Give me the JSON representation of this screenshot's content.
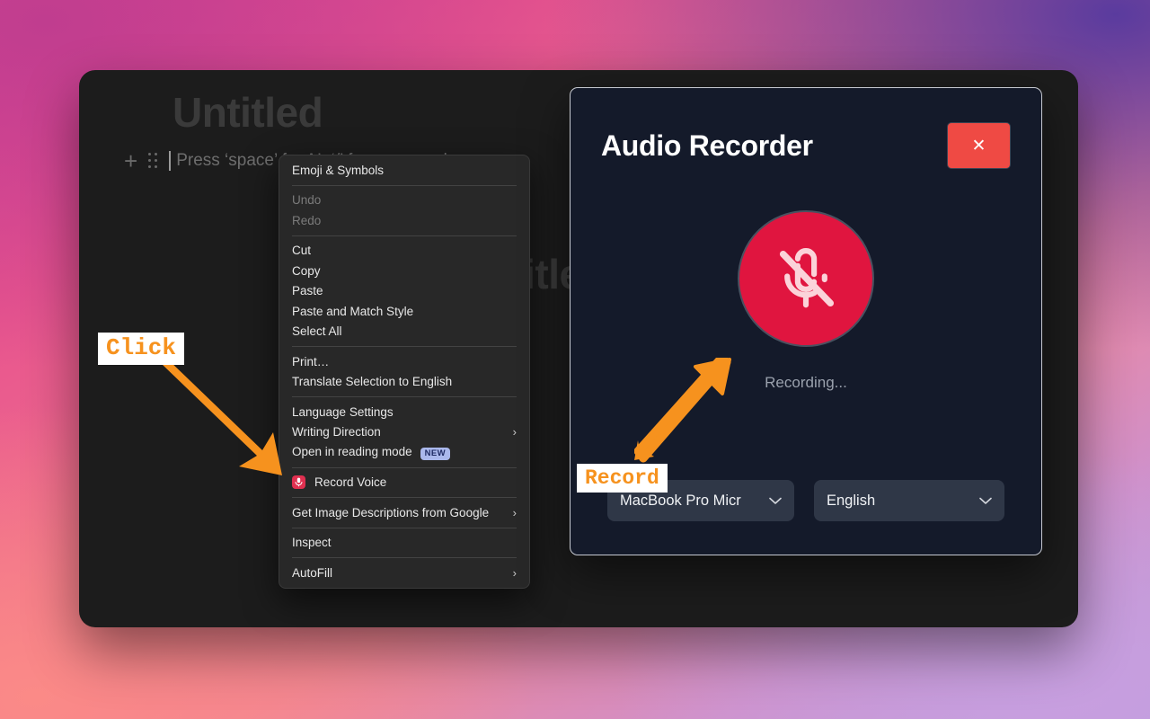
{
  "desktop": {
    "wallpaper_colors": [
      "#de4593",
      "#ef6f8d",
      "#5a3b9e",
      "#b89ddc",
      "#fb8a87"
    ]
  },
  "app_window": {
    "document_title": "Untitled",
    "document_title_ghost": "Untitled",
    "placeholder": "Press ‘space’ for AI, ‘/’ for commands…",
    "placeholder_visible": "Press ‘space’",
    "placeholder_ghost": "or AI,",
    "add_block_icon": "plus-icon",
    "drag_handle_icon": "drag-handle-icon",
    "background_color": "#1c1c1c"
  },
  "context_menu": {
    "groups": [
      {
        "items": [
          {
            "label": "Emoji & Symbols",
            "disabled": false,
            "submenu": false
          }
        ]
      },
      {
        "items": [
          {
            "label": "Undo",
            "disabled": true,
            "submenu": false
          },
          {
            "label": "Redo",
            "disabled": true,
            "submenu": false
          }
        ]
      },
      {
        "items": [
          {
            "label": "Cut",
            "disabled": false,
            "submenu": false
          },
          {
            "label": "Copy",
            "disabled": false,
            "submenu": false
          },
          {
            "label": "Paste",
            "disabled": false,
            "submenu": false
          },
          {
            "label": "Paste and Match Style",
            "disabled": false,
            "submenu": false
          },
          {
            "label": "Select All",
            "disabled": false,
            "submenu": false
          }
        ]
      },
      {
        "items": [
          {
            "label": "Print…",
            "disabled": false,
            "submenu": false
          },
          {
            "label": "Translate Selection to English",
            "disabled": false,
            "submenu": false
          }
        ]
      },
      {
        "items": [
          {
            "label": "Language Settings",
            "disabled": false,
            "submenu": false
          },
          {
            "label": "Writing Direction",
            "disabled": false,
            "submenu": true
          },
          {
            "label": "Open in reading mode",
            "disabled": false,
            "submenu": false,
            "badge": "NEW"
          }
        ]
      },
      {
        "items": [
          {
            "label": "Record Voice",
            "disabled": false,
            "submenu": false,
            "icon": "microphone-icon"
          }
        ]
      },
      {
        "items": [
          {
            "label": "Get Image Descriptions from Google",
            "disabled": false,
            "submenu": true
          }
        ]
      },
      {
        "items": [
          {
            "label": "Inspect",
            "disabled": false,
            "submenu": false
          }
        ]
      },
      {
        "items": [
          {
            "label": "AutoFill",
            "disabled": false,
            "submenu": true
          }
        ]
      }
    ],
    "submenu_arrow_glyph": "›",
    "background_color": "#282828"
  },
  "audio_recorder": {
    "title": "Audio Recorder",
    "close_label": "✕",
    "close_color": "#ef4a44",
    "mic_button_icon": "microphone-slash-icon",
    "mic_button_color": "#e0153f",
    "status": "Recording...",
    "device_select": {
      "value": "MacBook Pro Micr",
      "full_value": "MacBook Pro Microphone",
      "chevron_icon": "chevron-down-icon"
    },
    "language_select": {
      "value": "English",
      "chevron_icon": "chevron-down-icon"
    },
    "background_color": "#141a2a"
  },
  "annotations": {
    "accent_color": "#f6921e",
    "click": {
      "label": "Click"
    },
    "record": {
      "label": "Record"
    }
  }
}
